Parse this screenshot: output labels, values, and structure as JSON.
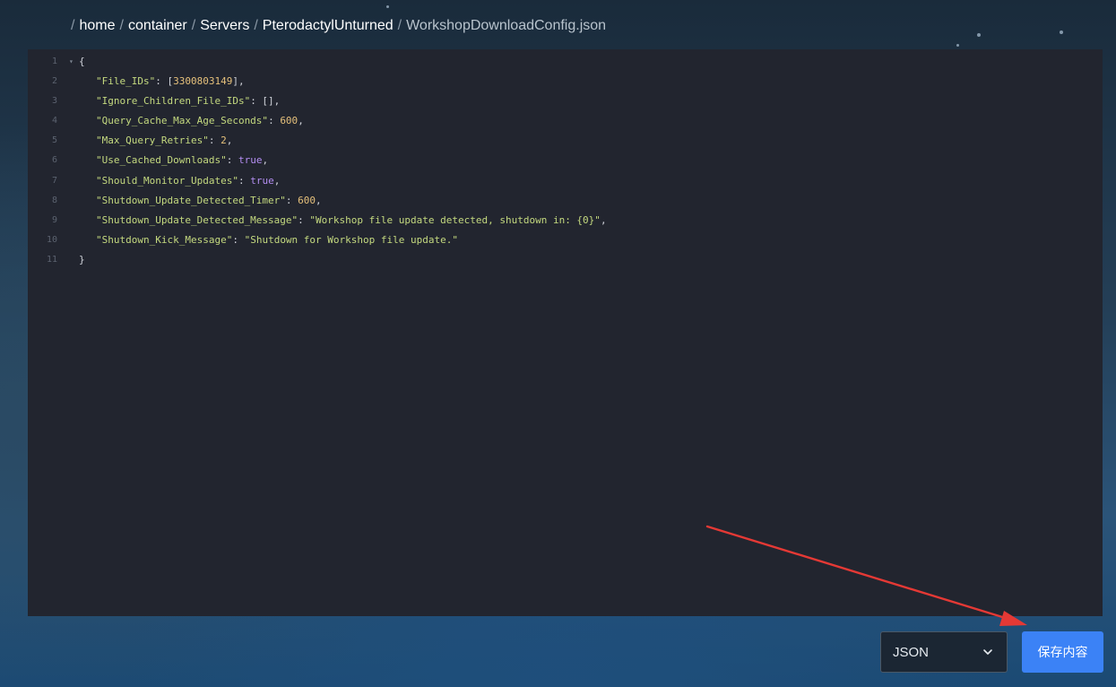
{
  "breadcrumb": [
    "home",
    "container",
    "Servers",
    "PterodactylUnturned",
    "WorkshopDownloadConfig.json"
  ],
  "editor": {
    "lines": [
      [
        {
          "t": "p",
          "v": "{"
        }
      ],
      [
        {
          "t": "key",
          "v": "\"File_IDs\""
        },
        {
          "t": "p",
          "v": ": ["
        },
        {
          "t": "num",
          "v": "3300803149"
        },
        {
          "t": "p",
          "v": "],"
        }
      ],
      [
        {
          "t": "key",
          "v": "\"Ignore_Children_File_IDs\""
        },
        {
          "t": "p",
          "v": ": [],"
        }
      ],
      [
        {
          "t": "key",
          "v": "\"Query_Cache_Max_Age_Seconds\""
        },
        {
          "t": "p",
          "v": ": "
        },
        {
          "t": "num",
          "v": "600"
        },
        {
          "t": "p",
          "v": ","
        }
      ],
      [
        {
          "t": "key",
          "v": "\"Max_Query_Retries\""
        },
        {
          "t": "p",
          "v": ": "
        },
        {
          "t": "num",
          "v": "2"
        },
        {
          "t": "p",
          "v": ","
        }
      ],
      [
        {
          "t": "key",
          "v": "\"Use_Cached_Downloads\""
        },
        {
          "t": "p",
          "v": ": "
        },
        {
          "t": "bool",
          "v": "true"
        },
        {
          "t": "p",
          "v": ","
        }
      ],
      [
        {
          "t": "key",
          "v": "\"Should_Monitor_Updates\""
        },
        {
          "t": "p",
          "v": ": "
        },
        {
          "t": "bool",
          "v": "true"
        },
        {
          "t": "p",
          "v": ","
        }
      ],
      [
        {
          "t": "key",
          "v": "\"Shutdown_Update_Detected_Timer\""
        },
        {
          "t": "p",
          "v": ": "
        },
        {
          "t": "num",
          "v": "600"
        },
        {
          "t": "p",
          "v": ","
        }
      ],
      [
        {
          "t": "key",
          "v": "\"Shutdown_Update_Detected_Message\""
        },
        {
          "t": "p",
          "v": ": "
        },
        {
          "t": "str",
          "v": "\"Workshop file update detected, shutdown in: {0}\""
        },
        {
          "t": "p",
          "v": ","
        }
      ],
      [
        {
          "t": "key",
          "v": "\"Shutdown_Kick_Message\""
        },
        {
          "t": "p",
          "v": ": "
        },
        {
          "t": "str",
          "v": "\"Shutdown for Workshop file update.\""
        }
      ],
      [
        {
          "t": "p",
          "v": "}"
        }
      ]
    ]
  },
  "mode_select": {
    "value": "JSON",
    "icon": "chevron-down-icon"
  },
  "save_button": {
    "label": "保存内容",
    "color": "#3b82f6"
  },
  "annotation": {
    "icon": "red-arrow-icon",
    "color": "#e53935"
  }
}
